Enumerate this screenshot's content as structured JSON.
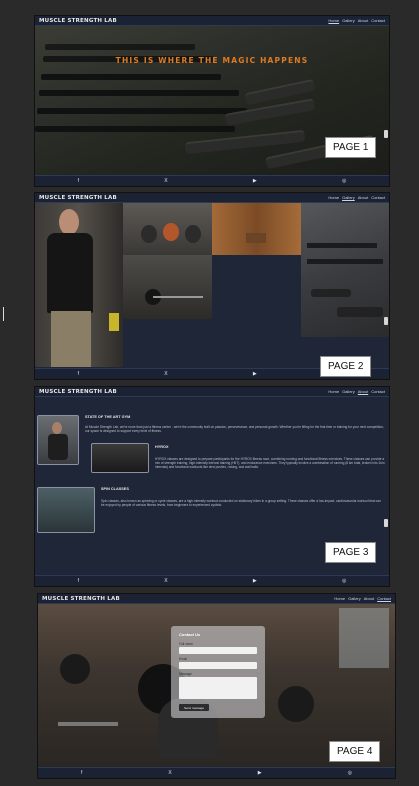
{
  "site": {
    "brand": "MUSCLE STRENGTH LAB",
    "nav": [
      "Home",
      "Gallery",
      "About",
      "Contact"
    ]
  },
  "footer_icons": [
    "facebook-icon",
    "x-icon",
    "youtube-icon",
    "instagram-icon"
  ],
  "footer_glyphs": [
    "f",
    "X",
    "▶",
    "◎"
  ],
  "page1": {
    "hero_title": "THIS IS WHERE THE MAGIC HAPPENS",
    "label": "PAGE 1",
    "active_nav": "Home"
  },
  "page2": {
    "label": "PAGE 2",
    "active_nav": "Gallery"
  },
  "page3": {
    "label": "PAGE 3",
    "active_nav": "About",
    "sections": [
      {
        "title": "STATE OF THE ART GYM",
        "text": "At Muscle Strength Lab, we're more than just a fitness center - we're the community built on passion, perseverance, and personal growth. Whether you're lifting for the first time or training for your next competition, our space is designed to support every level of fitness."
      },
      {
        "title": "HYROX",
        "text": "HYROX classes are designed to prepare participants for the HYROX fitness race, combining running and functional fitness exercises. These classes can provide a mix of strength training, high-intensity interval training (HIIT), and endurance exercises. They typically involve a combination of running (8 km total, broken into 1km intervals) and functional workouts like sled pushes, rowing, and wall balls."
      },
      {
        "title": "SPIN CLASSES",
        "text": "Spin classes, also known as spinning or cycle classes, are a high-intensity workout conducted on stationary bikes in a group setting. These classes offer a low-impact, cardiovascular workout that can be enjoyed by people of various fitness levels, from beginners to experienced cyclists."
      }
    ]
  },
  "page4": {
    "label": "PAGE 4",
    "active_nav": "Contact",
    "form": {
      "title": "Contact Us",
      "fields": [
        "Full name",
        "Email",
        "Message"
      ],
      "button": "Send message"
    }
  },
  "colors": {
    "page_bg": "#1f2637",
    "accent": "#e07b22",
    "canvas": "#2a2a2a"
  }
}
